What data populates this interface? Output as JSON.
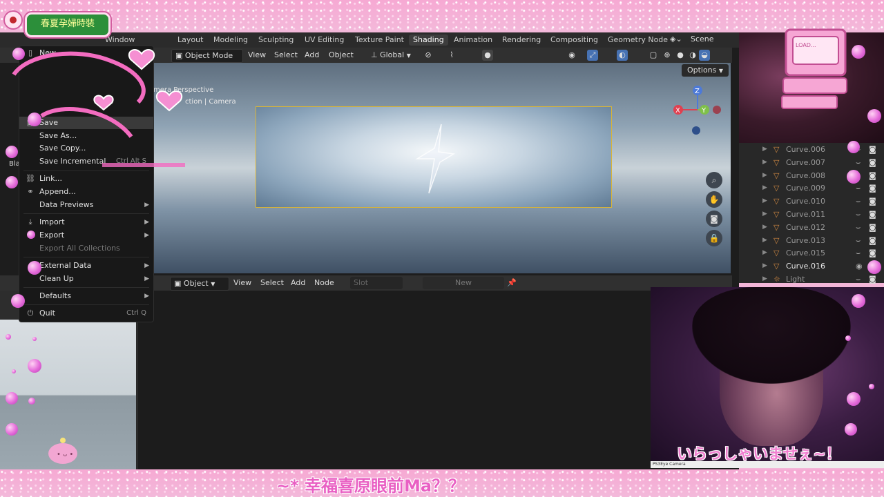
{
  "stream": {
    "title_badge": "春夏孕婦時裝",
    "bottom_text": "~* 幸福喜原眼前Ma？？",
    "webcam_caption": "いらっしゃいませぇ~！",
    "webcam_source": "PS3Eye Camera",
    "computer_screen": "LOAD..."
  },
  "topbar": {
    "menu_window": "Window",
    "tabs": [
      "Layout",
      "Modeling",
      "Sculpting",
      "UV Editing",
      "Texture Paint",
      "Shading",
      "Animation",
      "Rendering",
      "Compositing",
      "Geometry Node"
    ],
    "active_tab": "Shading",
    "scene": "Scene"
  },
  "viewport": {
    "mode": "Object Mode",
    "menus": [
      "View",
      "Select",
      "Add",
      "Object"
    ],
    "transform": "Global",
    "options": "Options",
    "camera_info_1": "mera Perspective",
    "camera_info_2": "ction | Camera",
    "gizmo": {
      "x": "X",
      "y": "Y",
      "z": "Z"
    }
  },
  "node_header": {
    "object": "Object",
    "menus": [
      "View",
      "Select",
      "Add",
      "Node"
    ],
    "slot": "Slot",
    "new": "New"
  },
  "file_menu": {
    "items": [
      {
        "label": "New",
        "icon": "file-icon",
        "shortcut": "",
        "arrow": false,
        "disabled": false
      },
      {
        "label": "Save",
        "icon": "save-icon",
        "shortcut": "",
        "arrow": false,
        "disabled": false
      },
      {
        "label": "Save As...",
        "icon": "",
        "shortcut": "",
        "arrow": false,
        "disabled": false
      },
      {
        "label": "Save Copy...",
        "icon": "",
        "shortcut": "",
        "arrow": false,
        "disabled": false
      },
      {
        "label": "Save Incremental",
        "icon": "",
        "shortcut": "Ctrl Alt S",
        "arrow": false,
        "disabled": false
      },
      {
        "label": "Link...",
        "icon": "link-icon",
        "shortcut": "",
        "arrow": false,
        "disabled": false
      },
      {
        "label": "Append...",
        "icon": "append-icon",
        "shortcut": "",
        "arrow": false,
        "disabled": false
      },
      {
        "label": "Data Previews",
        "icon": "",
        "shortcut": "",
        "arrow": true,
        "disabled": false
      },
      {
        "label": "Import",
        "icon": "import-icon",
        "shortcut": "",
        "arrow": true,
        "disabled": false
      },
      {
        "label": "Export",
        "icon": "export-icon",
        "shortcut": "",
        "arrow": true,
        "disabled": false
      },
      {
        "label": "Export All Collections",
        "icon": "",
        "shortcut": "",
        "arrow": false,
        "disabled": true
      },
      {
        "label": "External Data",
        "icon": "",
        "shortcut": "",
        "arrow": true,
        "disabled": false
      },
      {
        "label": "Clean Up",
        "icon": "",
        "shortcut": "",
        "arrow": true,
        "disabled": false
      },
      {
        "label": "Defaults",
        "icon": "",
        "shortcut": "",
        "arrow": true,
        "disabled": false
      },
      {
        "label": "Quit",
        "icon": "power-icon",
        "shortcut": "Ctrl Q",
        "arrow": false,
        "disabled": false
      }
    ]
  },
  "outliner": {
    "rows": [
      {
        "name": "Curve.006",
        "selected": false
      },
      {
        "name": "Curve.007",
        "selected": false
      },
      {
        "name": "Curve.008",
        "selected": false
      },
      {
        "name": "Curve.009",
        "selected": false
      },
      {
        "name": "Curve.010",
        "selected": false
      },
      {
        "name": "Curve.011",
        "selected": false
      },
      {
        "name": "Curve.012",
        "selected": false
      },
      {
        "name": "Curve.013",
        "selected": false
      },
      {
        "name": "Curve.015",
        "selected": false
      },
      {
        "name": "Curve.016",
        "selected": true
      },
      {
        "name": "Light",
        "selected": false
      }
    ]
  },
  "left_panel": {
    "label": "Bla"
  },
  "colors": {
    "accent": "#4772b3",
    "camera_frame": "#d8b437",
    "bubble": "#e46ad9",
    "caption": "#f17fd0"
  }
}
